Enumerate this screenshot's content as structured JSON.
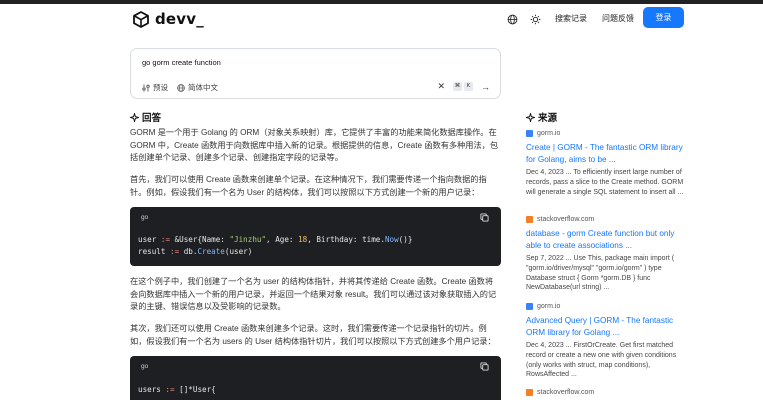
{
  "header": {
    "logo_text": "devv_",
    "history_label": "搜索记录",
    "feedback_label": "问题反馈",
    "login_label": "登录"
  },
  "search": {
    "query": "go gorm create function",
    "preset_label": "预设",
    "language_label": "简体中文",
    "kbd_1": "⌘",
    "kbd_2": "K"
  },
  "answer": {
    "title": "回答",
    "para1": "GORM 是一个用于 Golang 的 ORM（对象关系映射）库，它提供了丰富的功能来简化数据库操作。在 GORM 中，Create 函数用于向数据库中插入新的记录。根据提供的信息，Create 函数有多种用法，包括创建单个记录、创建多个记录、创建指定字段的记录等。",
    "para2": "首先，我们可以使用 Create 函数来创建单个记录。在这种情况下，我们需要传递一个指向数据的指针。例如，假设我们有一个名为 User 的结构体，我们可以按照以下方式创建一个新的用户记录：",
    "code1_lang": "go",
    "para3": "在这个例子中，我们创建了一个名为 user 的结构体指针，并将其传递给 Create 函数。Create 函数将会向数据库中插入一个新的用户记录，并返回一个结果对象 result。我们可以通过该对象获取插入的记录的主键、错误信息以及受影响的记录数。",
    "para4": "其次，我们还可以使用 Create 函数来创建多个记录。这时，我们需要传递一个记录指针的切片。例如，假设我们有一个名为 users 的 User 结构体指针切片，我们可以按照以下方式创建多个用户记录：",
    "code2_lang": "go",
    "code1": {
      "l1_a": "user",
      "l1_b": " := ",
      "l1_c": "&User{Name: ",
      "l1_d": "\"Jinzhu\"",
      "l1_e": ", Age: ",
      "l1_f": "18",
      "l1_g": ", Birthday: time.",
      "l1_h": "Now",
      "l1_i": "()}",
      "l2_a": "result",
      "l2_b": " := ",
      "l2_c": "db.",
      "l2_d": "Create",
      "l2_e": "(user)"
    },
    "code2": {
      "l1_a": "users",
      "l1_b": " := ",
      "l1_c": "[]*User{"
    }
  },
  "sources": {
    "title": "来源",
    "items": [
      {
        "domain": "gorm.io",
        "title": "Create | GORM - The fantastic ORM library for Golang, aims to be ...",
        "snippet": "Dec 4, 2023 ... To efficiently insert large number of records, pass a slice to the Create method. GORM will generate a single SQL statement to insert all ...",
        "favicon_color": "#3b82f6"
      },
      {
        "domain": "stackoverflow.com",
        "title": "database - gorm Create function but only able to create associations ...",
        "snippet": "Sep 7, 2022 ... Use This, package main import ( \"gorm.io/driver/mysql\" \"gorm.io/gorm\" ) type Database struct { Gorm *gorm.DB } func NewDatabase(url string) ...",
        "favicon_color": "#f48024"
      },
      {
        "domain": "gorm.io",
        "title": "Advanced Query | GORM - The fantastic ORM library for Golang ...",
        "snippet": "Dec 4, 2023 ... FirstOrCreate. Get first matched record or create a new one with given conditions (only works with struct, map conditions), RowsAffected ...",
        "favicon_color": "#3b82f6"
      },
      {
        "domain": "stackoverflow.com",
        "favicon_color": "#f48024"
      }
    ]
  },
  "colors": {
    "accent": "#1677ff",
    "code_bg": "#1e1f22"
  }
}
